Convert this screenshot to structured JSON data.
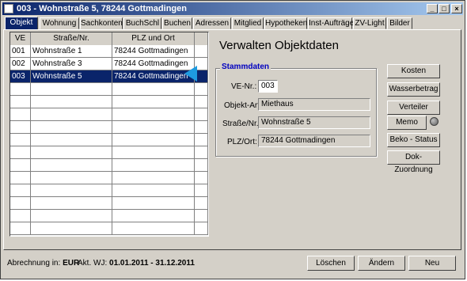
{
  "window": {
    "title": "003 - Wohnstraße 5, 78244 Gottmadingen"
  },
  "tabs": [
    {
      "label": "Objekt"
    },
    {
      "label": "Wohnung"
    },
    {
      "label": "Sachkonten"
    },
    {
      "label": "BuchSchl"
    },
    {
      "label": "Buchen"
    },
    {
      "label": "Adressen"
    },
    {
      "label": "Mitglied"
    },
    {
      "label": "Hypotheken"
    },
    {
      "label": "Inst-Aufträge"
    },
    {
      "label": "ZV-Light"
    },
    {
      "label": "Bilder"
    }
  ],
  "grid": {
    "headers": {
      "ve": "VE",
      "street": "Straße/Nr.",
      "plz": "PLZ und Ort"
    },
    "rows": [
      {
        "ve": "001",
        "street": "Wohnstraße 1",
        "plz": "78244 Gottmadingen"
      },
      {
        "ve": "002",
        "street": "Wohnstraße 3",
        "plz": "78244 Gottmadingen"
      },
      {
        "ve": "003",
        "street": "Wohnstraße 5",
        "plz": "78244 Gottmadingen"
      }
    ]
  },
  "main": {
    "heading": "Verwalten Objektdaten",
    "group_label": "Stammdaten",
    "fields": {
      "ve_label": "VE-Nr.:",
      "ve_value": "003",
      "art_label": "Objekt-Art:",
      "art_value": "Miethaus",
      "street_label": "Straße/Nr.:",
      "street_value": "Wohnstraße 5",
      "plz_label": "PLZ/Ort:",
      "plz_value": "78244 Gottmadingen"
    }
  },
  "side_buttons": {
    "kosten": "Kosten",
    "wasser": "Wasserbetrag",
    "verteiler": "Verteiler",
    "memo": "Memo",
    "beko": "Beko - Status",
    "dok": "Dok-Zuordnung"
  },
  "status": {
    "abrechnung_label": "Abrechnung in:",
    "currency": "EUR",
    "wj_label": "Akt. WJ:",
    "wj_value": "01.01.2011 - 31.12.2011"
  },
  "bottom_buttons": {
    "loeschen": "Löschen",
    "aendern": "Ändern",
    "neu": "Neu"
  },
  "colors": {
    "selection": "#0a246a",
    "group_label": "#0000c0",
    "arrow": "#1e9be0"
  }
}
